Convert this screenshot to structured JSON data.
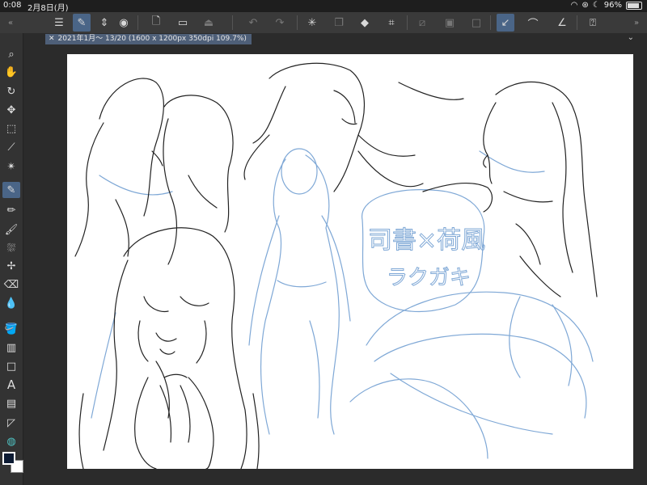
{
  "status_bar": {
    "time": "0:08",
    "date": "2月8日(月)",
    "battery": "96%"
  },
  "document": {
    "tab_title": "2021年1月〜 13/20 (1600 x 1200px 350dpi 109.7%)"
  },
  "canvas_text": {
    "title_line": "司書×荷風",
    "subtitle_line": "ラクガキ"
  },
  "colors": {
    "accent": "#4a6587",
    "foreground_color": "#0d1b33",
    "background_color": "#ffffff",
    "sketch_blue": "#7fa8d6",
    "sketch_ink": "#222222"
  },
  "command_bar": {
    "icons": [
      "menu-icon",
      "pen-settings-icon",
      "chevron-updown-icon",
      "color-wheel-icon",
      "new-file-icon",
      "open-folder-icon",
      "save-icon",
      "undo-icon",
      "redo-icon",
      "loading-icon",
      "copy-icon",
      "fill-icon",
      "transform-icon",
      "layer-toggle-icon",
      "layer-box-icon",
      "layer-square-icon",
      "pen-pressure-icon",
      "brush-icon",
      "ruler-icon",
      "help-icon"
    ]
  },
  "tool_strip": {
    "icons": [
      "zoom-icon",
      "hand-icon",
      "rotate-icon",
      "move-icon",
      "selection-icon",
      "eyedropper-icon",
      "magic-wand-icon",
      "pen-icon",
      "pencil-icon",
      "brush-icon",
      "airbrush-icon",
      "decoration-icon",
      "eraser-icon",
      "blend-icon",
      "fill-icon",
      "gradient-icon",
      "shape-icon",
      "text-icon",
      "frame-icon",
      "ruler-icon",
      "correction-icon"
    ]
  }
}
